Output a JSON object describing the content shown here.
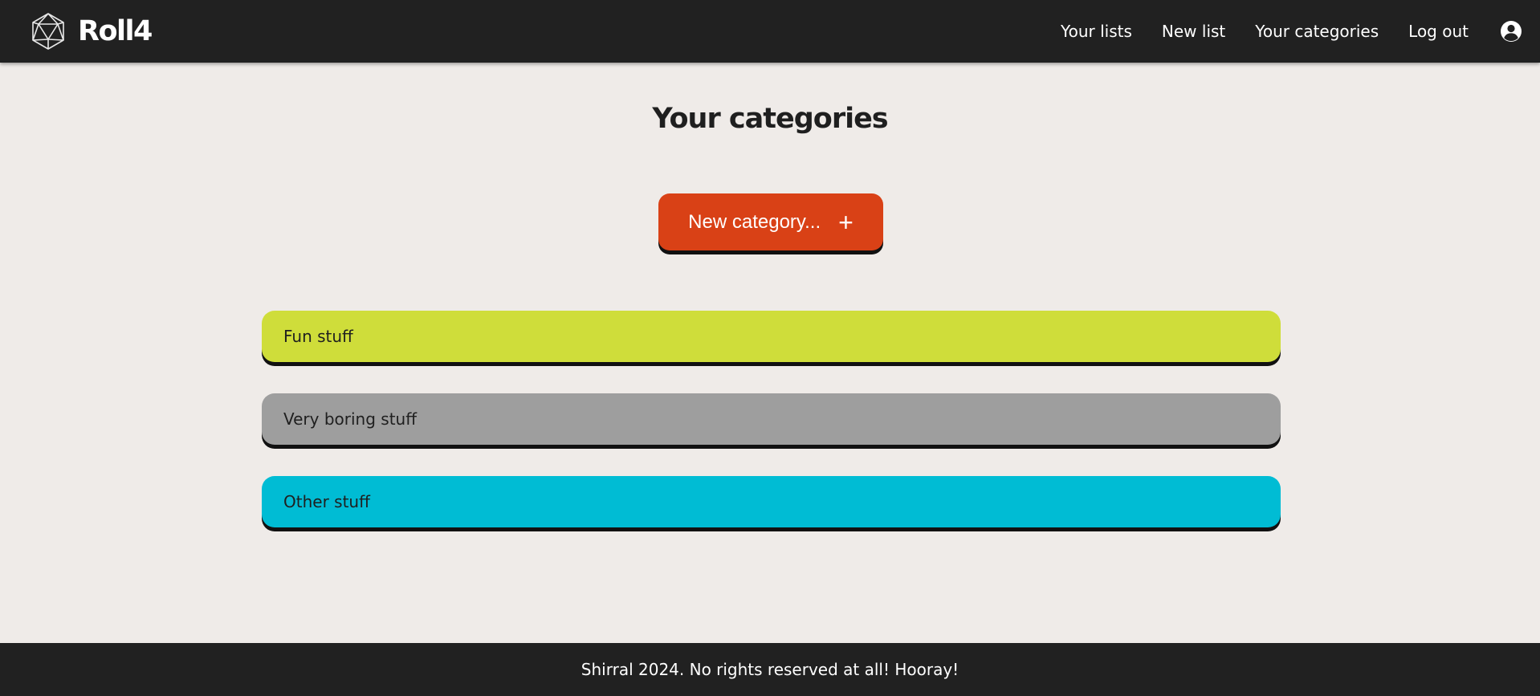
{
  "header": {
    "brand_name": "Roll4",
    "brand_icon": "d20-dice-icon",
    "nav": [
      {
        "label": "Your lists"
      },
      {
        "label": "New list"
      },
      {
        "label": "Your categories"
      },
      {
        "label": "Log out"
      }
    ],
    "user_icon": "account-circle-icon"
  },
  "main": {
    "title": "Your categories",
    "new_button_label": "New category...",
    "new_button_icon": "+",
    "categories": [
      {
        "name": "Fun stuff",
        "color": "#cfdd3a"
      },
      {
        "name": "Very boring stuff",
        "color": "#9e9e9e"
      },
      {
        "name": "Other stuff",
        "color": "#00bcd4"
      }
    ]
  },
  "footer": {
    "text": "Shirral 2024. No rights reserved at all! Hooray!"
  },
  "colors": {
    "header_bg": "#212121",
    "page_bg": "#efebe8",
    "accent": "#d94116"
  }
}
